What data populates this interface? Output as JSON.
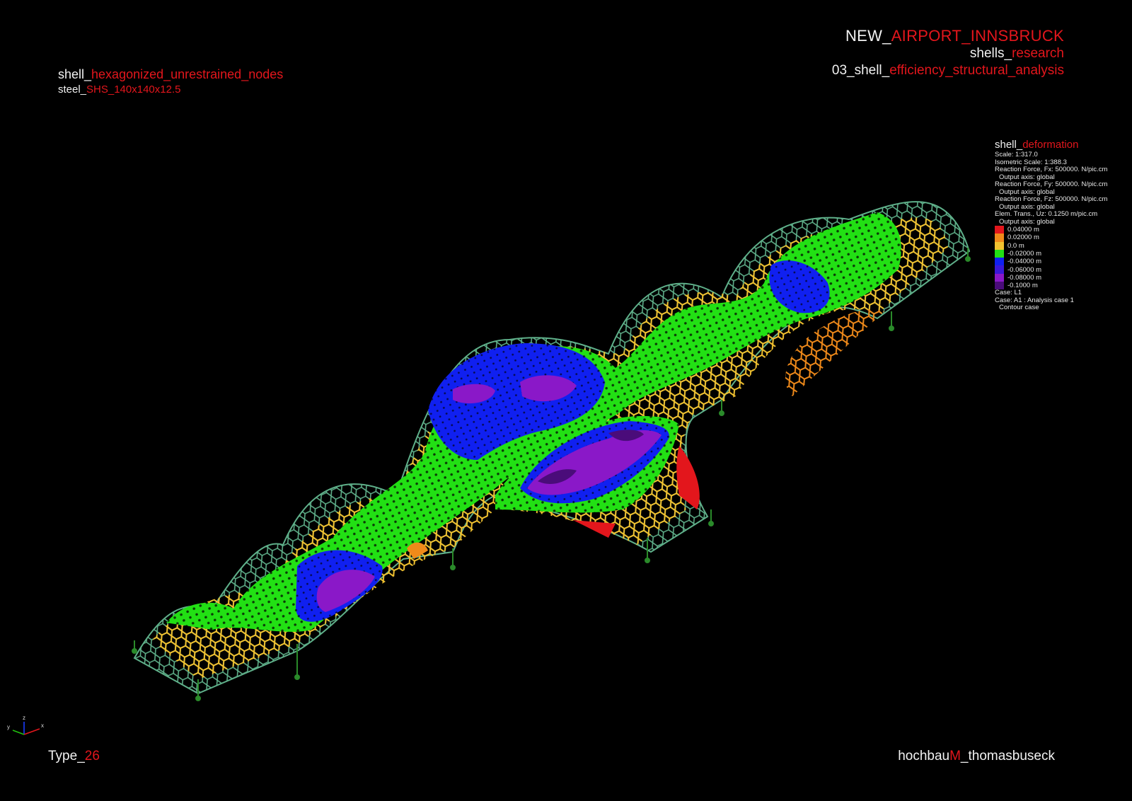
{
  "title_block": {
    "line1": {
      "prefix": "NEW_",
      "accent": "AIRPORT_INNSBRUCK"
    },
    "line2": {
      "prefix": "shells_",
      "accent": "research"
    },
    "line3": {
      "prefix": "03_shell_",
      "accent": "efficiency_structural_analysis"
    }
  },
  "subject_block": {
    "line1": {
      "prefix": "shell_",
      "accent": "hexagonized_unrestrained_nodes"
    },
    "line2": {
      "prefix": "steel_",
      "accent": "SHS_140x140x12.5"
    }
  },
  "legend": {
    "heading": {
      "prefix": "shell_",
      "accent": "deformation"
    },
    "info_lines": [
      "Scale: 1:317.0",
      "Isometric Scale: 1:388.3",
      "Reaction Force, Fx: 500000. N/pic.cm",
      "Output axis: global",
      "Reaction Force, Fy: 500000. N/pic.cm",
      "Output axis: global",
      "Reaction Force, Fz: 500000. N/pic.cm",
      "Output axis: global",
      "Elem. Trans., Uz: 0.1250 m/pic.cm",
      "Output axis: global"
    ],
    "contour_levels": [
      {
        "label": "0.04000 m",
        "color": "#e3161c"
      },
      {
        "label": "0.02000 m",
        "color": "#f08a1a"
      },
      {
        "label": "0.0 m",
        "color": "#f2c230"
      },
      {
        "label": "-0.02000 m",
        "color": "#22e014"
      },
      {
        "label": "-0.04000 m",
        "color": "#1020f0"
      },
      {
        "label": "-0.06000 m",
        "color": "#3a18d8"
      },
      {
        "label": "-0.08000 m",
        "color": "#8a18c8"
      },
      {
        "label": "-0.1000 m",
        "color": "#4a0c7a"
      }
    ],
    "case_lines": [
      "Case: L1",
      "Case: A1 : Analysis case 1",
      "Contour case"
    ]
  },
  "axis_triad": {
    "x": "x",
    "y": "y",
    "z": "z"
  },
  "footer": {
    "type": {
      "prefix": "Type_",
      "accent": "26"
    },
    "credit": {
      "prefix": "hochbau",
      "accent": "M",
      "suffix": "_thomasbuseck"
    }
  },
  "colors": {
    "accent": "#e3161c",
    "text": "#f2f2f2",
    "background": "#000000"
  }
}
